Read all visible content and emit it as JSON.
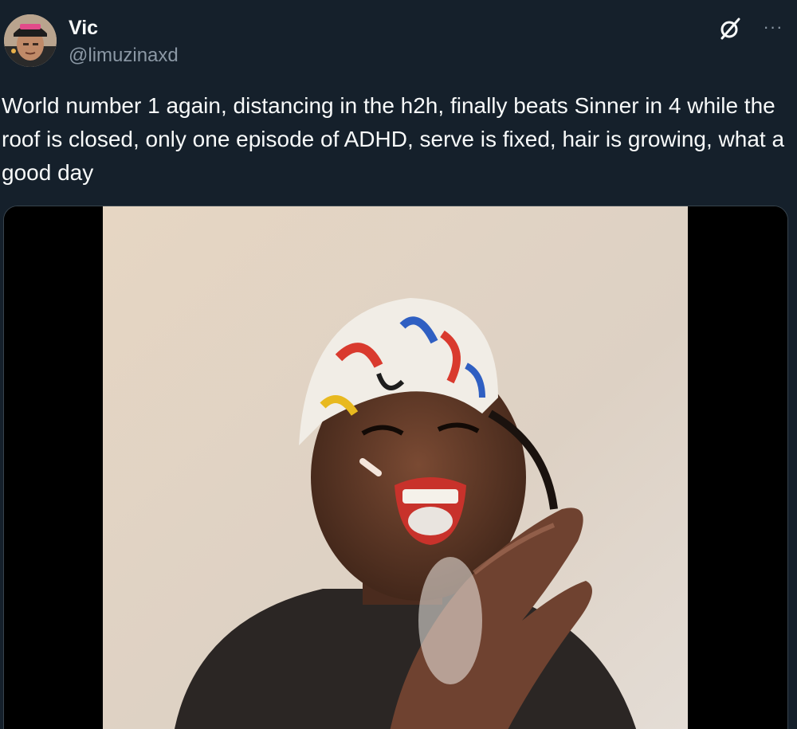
{
  "tweet": {
    "author_name": "Vic",
    "author_handle": "@limuzinaxd",
    "text": "World number 1 again, distancing in the h2h, finally beats Sinner in 4 while the roof is closed, only one episode of ADHD, serve is fixed, hair is growing, what a good day",
    "more_label": "···"
  },
  "icons": {
    "brand": "x-logo-icon",
    "more": "more-icon"
  },
  "colors": {
    "background": "#15202b",
    "text_primary": "#f7f9f9",
    "text_secondary": "#8b98a5",
    "border": "#38444d"
  }
}
